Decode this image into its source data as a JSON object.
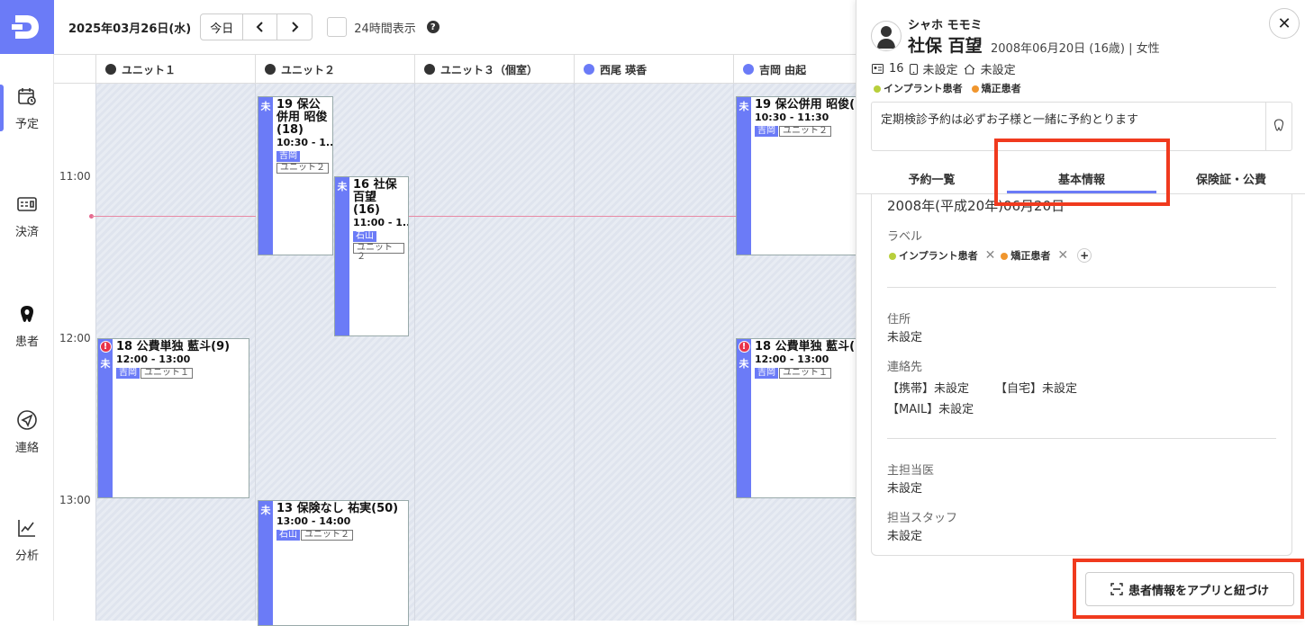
{
  "sidebar": {
    "logo_icon": "dental-logo-icon",
    "items": [
      {
        "label": "予定",
        "icon": "calendar-icon"
      },
      {
        "label": "決済",
        "icon": "register-icon"
      },
      {
        "label": "患者",
        "icon": "tooth-icon"
      },
      {
        "label": "連絡",
        "icon": "send-icon"
      },
      {
        "label": "分析",
        "icon": "chart-icon"
      }
    ]
  },
  "topbar": {
    "date": "2025年03月26日(水)",
    "today": "今日",
    "prev": "‹",
    "next": "›",
    "toggle_24h": "24時間表示",
    "help": "?"
  },
  "columns": [
    {
      "label": "ユニット１",
      "type": "unit"
    },
    {
      "label": "ユニット２",
      "type": "unit"
    },
    {
      "label": "ユニット３（個室）",
      "type": "unit"
    },
    {
      "label": "西尾 瑛香",
      "type": "person"
    },
    {
      "label": "吉岡 由起",
      "type": "person"
    }
  ],
  "times": [
    "11:00",
    "12:00",
    "13:00"
  ],
  "appointments": [
    {
      "title": "19 保公併用 昭俊(18)",
      "time": "10:30 - 1...",
      "status": "未",
      "staff": "吉岡",
      "unit": "ユニット２"
    },
    {
      "title": "16 社保 百望 (16)",
      "time": "11:00 - 1...",
      "status": "未",
      "staff": "石山",
      "unit": "ユニット２"
    },
    {
      "title": "18 公費単独 藍斗(9)",
      "time": "12:00 - 13:00",
      "status": "未",
      "warn": "!",
      "staff": "吉岡",
      "unit": "ユニット１"
    },
    {
      "title": "13 保険なし 祐実(50)",
      "time": "13:00 - 14:00",
      "status": "未",
      "staff": "石山",
      "unit": "ユニット２"
    },
    {
      "title": "19 保公併用 昭俊(",
      "time": "10:30 - 11:30",
      "status": "未",
      "staff": "吉岡",
      "unit": "ユニット２"
    },
    {
      "title": "18 公費単独 藍斗(",
      "time": "12:00 - 13:00",
      "status": "未",
      "warn": "!",
      "staff": "吉岡",
      "unit": "ユニット１"
    }
  ],
  "panel": {
    "kana": "シャホ モモミ",
    "name": "社保 百望",
    "info": "2008年06月20日 (16歳) | 女性",
    "close": "✕",
    "meta": {
      "id": "16",
      "phone": "未設定",
      "home": "未設定"
    },
    "labels": [
      {
        "text": "インプラント患者",
        "color": "#b8cf3c"
      },
      {
        "text": "矯正患者",
        "color": "#f0962e"
      }
    ],
    "memo": "定期検診予約は必ずお子様と一緒に予約とります",
    "tabs": [
      "予約一覧",
      "基本情報",
      "保険証・公費"
    ],
    "active_tab": "基本情報",
    "birth": "2008年(平成20年)06月20日",
    "label_heading": "ラベル",
    "address_heading": "住所",
    "address_value": "未設定",
    "contact_heading": "連絡先",
    "contact_mobile": "【携帯】未設定",
    "contact_home": "【自宅】未設定",
    "contact_mail": "【MAIL】未設定",
    "doctor_heading": "主担当医",
    "doctor_value": "未設定",
    "staff_heading": "担当スタッフ",
    "staff_value": "未設定",
    "link_button": "患者情報をアプリと紐づけ"
  },
  "colors": {
    "accent": "#6b7bf7",
    "highlight": "#f03a1e",
    "now_line": "#e88aa4"
  }
}
